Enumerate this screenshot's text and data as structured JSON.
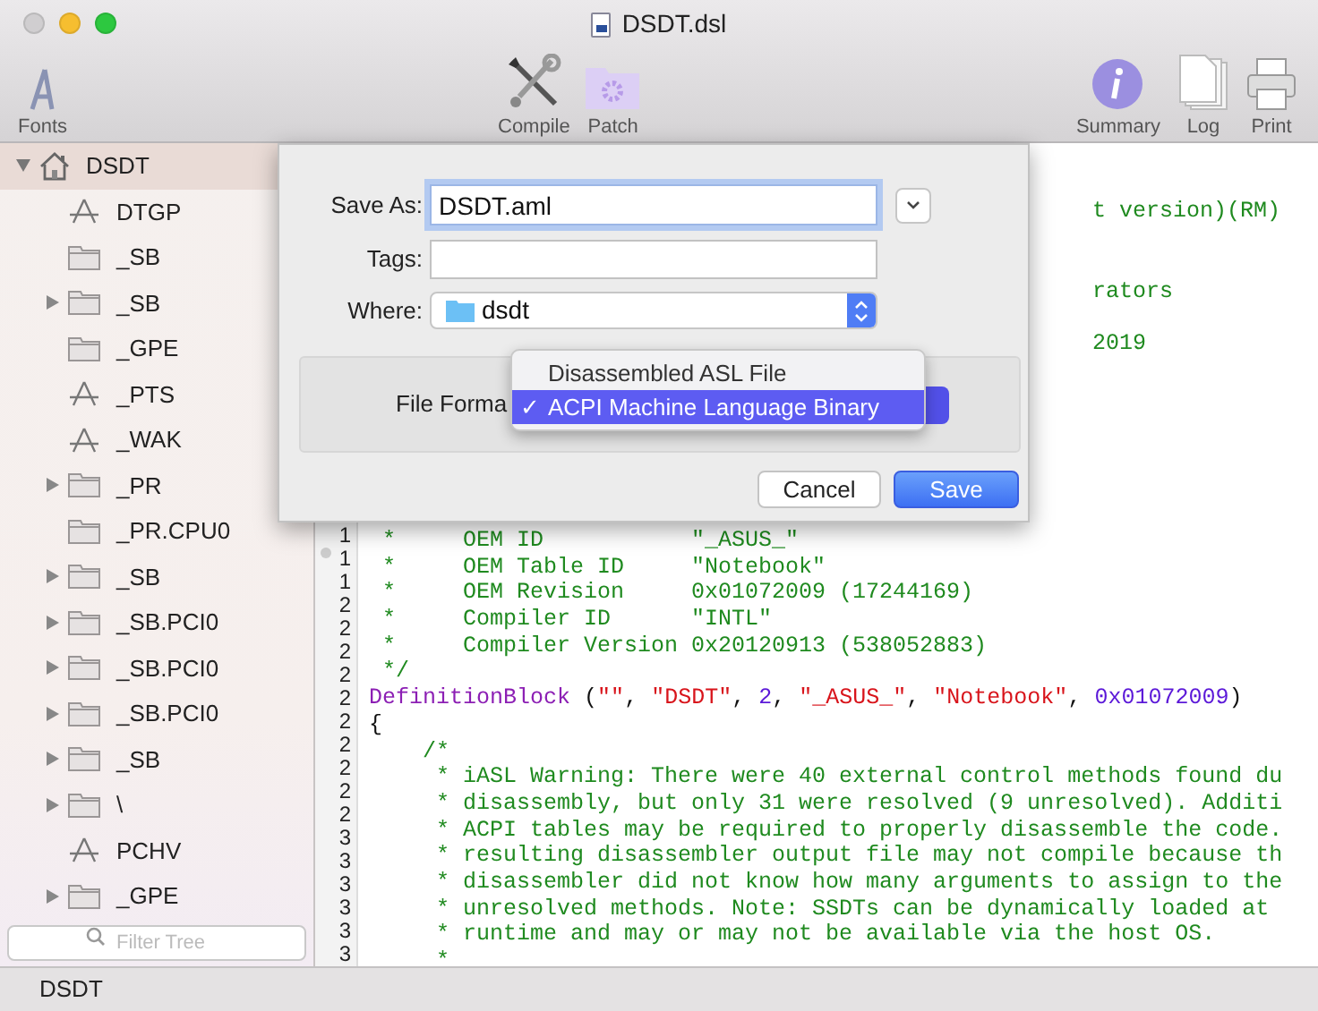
{
  "window": {
    "title": "DSDT.dsl"
  },
  "toolbar": {
    "left": [
      {
        "label": "Fonts"
      }
    ],
    "center": [
      {
        "label": "Compile"
      },
      {
        "label": "Patch"
      }
    ],
    "right": [
      {
        "label": "Summary"
      },
      {
        "label": "Log"
      },
      {
        "label": "Print"
      }
    ]
  },
  "sidebar": {
    "tree": [
      {
        "label": "DSDT",
        "kind": "root",
        "expanded": true,
        "selected": true,
        "children": [
          {
            "label": "DTGP",
            "kind": "method",
            "selected": false
          },
          {
            "label": "_SB",
            "kind": "folder",
            "selected": false
          },
          {
            "label": "_SB",
            "kind": "folder",
            "expanded": false,
            "selected": false
          },
          {
            "label": "_GPE",
            "kind": "folder",
            "selected": false
          },
          {
            "label": "_PTS",
            "kind": "method",
            "selected": false
          },
          {
            "label": "_WAK",
            "kind": "method",
            "selected": false
          },
          {
            "label": "_PR",
            "kind": "folder",
            "expanded": false,
            "selected": false
          },
          {
            "label": "_PR.CPU0",
            "kind": "folder",
            "selected": false
          },
          {
            "label": "_SB",
            "kind": "folder",
            "expanded": false,
            "selected": false
          },
          {
            "label": "_SB.PCI0",
            "kind": "folder",
            "expanded": false,
            "selected": false
          },
          {
            "label": "_SB.PCI0",
            "kind": "folder",
            "expanded": false,
            "selected": false
          },
          {
            "label": "_SB.PCI0",
            "kind": "folder",
            "expanded": false,
            "selected": false
          },
          {
            "label": "_SB",
            "kind": "folder",
            "expanded": false,
            "selected": false
          },
          {
            "label": "\\",
            "kind": "folder",
            "expanded": false,
            "selected": false
          },
          {
            "label": "PCHV",
            "kind": "method",
            "selected": false
          },
          {
            "label": "_GPE",
            "kind": "folder",
            "expanded": false,
            "selected": false
          }
        ]
      }
    ],
    "filter": {
      "placeholder": "Filter Tree"
    }
  },
  "editor": {
    "partial_lines": [
      "t version)(RM)",
      "rators",
      "2019"
    ],
    "gutter": [
      "1",
      "1",
      "1",
      "2",
      "2",
      "2",
      "2",
      "2",
      "2",
      "2",
      "2",
      "2",
      "2",
      "3",
      "3",
      "3",
      "3",
      "3",
      "3"
    ],
    "lines": [
      [
        {
          "kind": "comment",
          "text": " *     OEM ID           \"_ASUS_\""
        }
      ],
      [
        {
          "kind": "comment",
          "text": " *     OEM Table ID     \"Notebook\""
        }
      ],
      [
        {
          "kind": "comment",
          "text": " *     OEM Revision     0x01072009 (17244169)"
        }
      ],
      [
        {
          "kind": "comment",
          "text": " *     Compiler ID      \"INTL\""
        }
      ],
      [
        {
          "kind": "comment",
          "text": " *     Compiler Version 0x20120913 (538052883)"
        }
      ],
      [
        {
          "kind": "comment",
          "text": " */"
        }
      ],
      [
        {
          "kind": "keyword",
          "text": "DefinitionBlock"
        },
        {
          "kind": "plain",
          "text": " ("
        },
        {
          "kind": "string",
          "text": "\"\""
        },
        {
          "kind": "plain",
          "text": ", "
        },
        {
          "kind": "string",
          "text": "\"DSDT\""
        },
        {
          "kind": "plain",
          "text": ", "
        },
        {
          "kind": "number",
          "text": "2"
        },
        {
          "kind": "plain",
          "text": ", "
        },
        {
          "kind": "string",
          "text": "\"_ASUS_\""
        },
        {
          "kind": "plain",
          "text": ", "
        },
        {
          "kind": "string",
          "text": "\"Notebook\""
        },
        {
          "kind": "plain",
          "text": ", "
        },
        {
          "kind": "number",
          "text": "0x01072009"
        },
        {
          "kind": "plain",
          "text": ")"
        }
      ],
      [
        {
          "kind": "plain",
          "text": "{"
        }
      ],
      [
        {
          "kind": "comment",
          "text": "    /*"
        }
      ],
      [
        {
          "kind": "comment",
          "text": "     * iASL Warning: There were 40 external control methods found du"
        }
      ],
      [
        {
          "kind": "comment",
          "text": "     * disassembly, but only 31 were resolved (9 unresolved). Additi"
        }
      ],
      [
        {
          "kind": "comment",
          "text": "     * ACPI tables may be required to properly disassemble the code."
        }
      ],
      [
        {
          "kind": "comment",
          "text": "     * resulting disassembler output file may not compile because th"
        }
      ],
      [
        {
          "kind": "comment",
          "text": "     * disassembler did not know how many arguments to assign to the"
        }
      ],
      [
        {
          "kind": "comment",
          "text": "     * unresolved methods. Note: SSDTs can be dynamically loaded at"
        }
      ],
      [
        {
          "kind": "comment",
          "text": "     * runtime and may or may not be available via the host OS."
        }
      ],
      [
        {
          "kind": "comment",
          "text": "     *"
        }
      ]
    ]
  },
  "status_bar": {
    "text": "DSDT"
  },
  "save_sheet": {
    "save_as": {
      "label": "Save As:",
      "value": "DSDT.aml"
    },
    "tags": {
      "label": "Tags:"
    },
    "where": {
      "label": "Where:",
      "value": "dsdt"
    },
    "file_format": {
      "label": "File Forma",
      "options": [
        {
          "label": "Disassembled ASL File",
          "selected": false
        },
        {
          "label": "ACPI Machine Language Binary",
          "selected": true
        }
      ],
      "check": "✓"
    },
    "buttons": [
      {
        "label": "Cancel",
        "kind": "secondary"
      },
      {
        "label": "Save",
        "kind": "primary"
      }
    ]
  }
}
